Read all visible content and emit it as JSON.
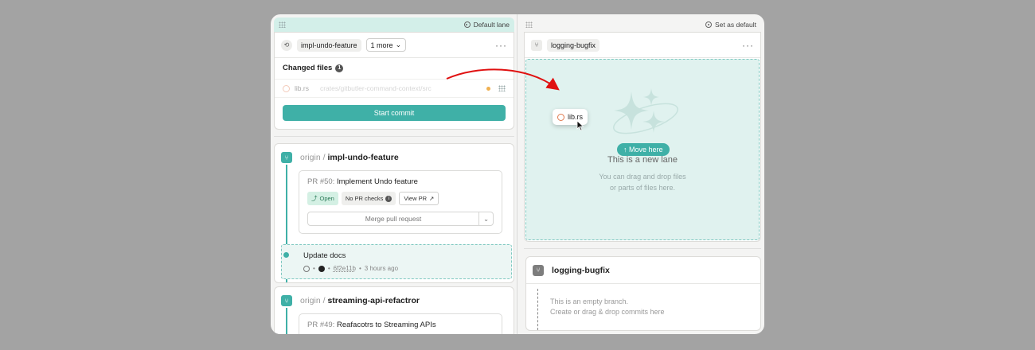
{
  "left_lane": {
    "lane_label": "Default lane",
    "branch_chip": "impl-undo-feature",
    "more_button": "1 more",
    "changed_files_label": "Changed files",
    "changed_files_count": "1",
    "file": {
      "name": "lib.rs",
      "path": "crates/gitbutler-command-context/src"
    },
    "commit_button": "Start commit",
    "stacks": [
      {
        "origin": "origin /",
        "name": "impl-undo-feature",
        "pr": {
          "number": "PR #50:",
          "title": "Implement Undo feature",
          "status": "Open",
          "checks": "No PR checks",
          "view": "View PR",
          "merge": "Merge pull request"
        },
        "commit": {
          "title": "Update docs",
          "sha": "6f2e11b",
          "time": "3 hours ago"
        }
      },
      {
        "origin": "origin /",
        "name": "streaming-api-refactror",
        "pr": {
          "number": "PR #49:",
          "title": "Reafacotrs to Streaming APIs"
        }
      }
    ]
  },
  "right_lane": {
    "lane_label": "Set as default",
    "branch_chip": "logging-bugfix",
    "empty_title": "This is a new lane",
    "empty_sub_line1": "You can drag and drop files",
    "empty_sub_line2": "or parts of files here.",
    "move_here": "Move here",
    "branch_name": "logging-bugfix",
    "empty_branch_line1": "This is an empty branch.",
    "empty_branch_line2": "Create or drag & drop commits here"
  },
  "drag": {
    "file_name": "lib.rs"
  },
  "colors": {
    "accent": "#3fb0a7",
    "arrow": "#e01010",
    "lane_highlight": "#d3efe9"
  }
}
